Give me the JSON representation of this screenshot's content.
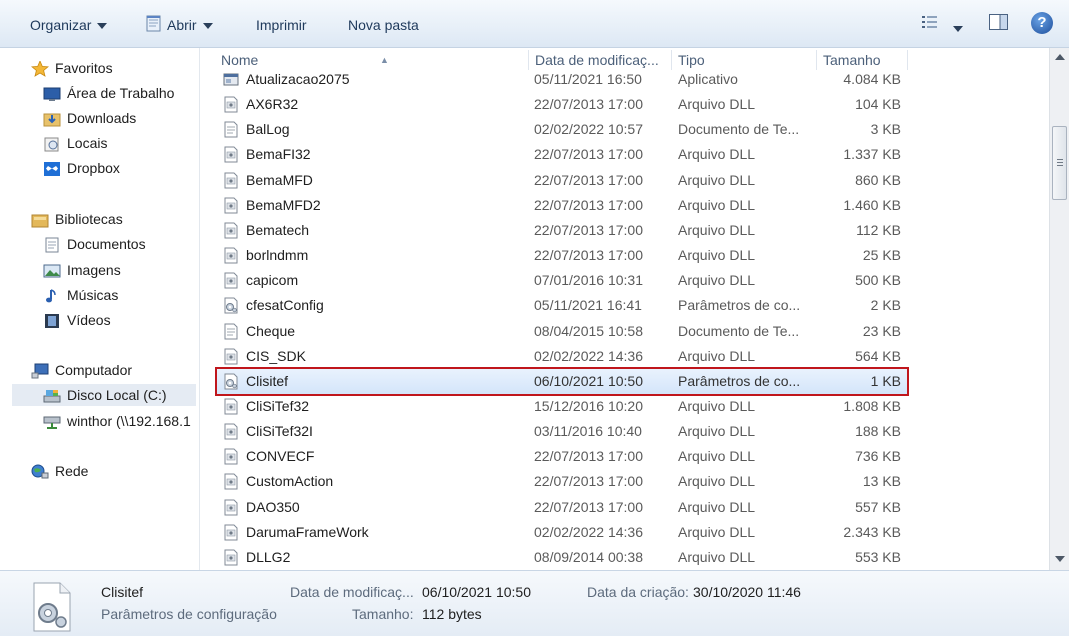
{
  "toolbar": {
    "organize": "Organizar",
    "open": "Abrir",
    "print": "Imprimir",
    "new_folder": "Nova pasta",
    "help": "?"
  },
  "nav": {
    "favorites": {
      "label": "Favoritos",
      "items": [
        "Área de Trabalho",
        "Downloads",
        "Locais",
        "Dropbox"
      ]
    },
    "libraries": {
      "label": "Bibliotecas",
      "items": [
        "Documentos",
        "Imagens",
        "Músicas",
        "Vídeos"
      ]
    },
    "computer": {
      "label": "Computador",
      "items": [
        "Disco Local (C:)",
        "winthor (\\\\192.168.1"
      ]
    },
    "network": {
      "label": "Rede"
    }
  },
  "columns": {
    "name": "Nome",
    "modified": "Data de modificaç...",
    "type": "Tipo",
    "size": "Tamanho"
  },
  "files": [
    {
      "name": "Atualizacao2075",
      "modified": "05/11/2021 16:50",
      "type": "Aplicativo",
      "size": "4.084 KB",
      "icon": "app-icon"
    },
    {
      "name": "AX6R32",
      "modified": "22/07/2013 17:00",
      "type": "Arquivo DLL",
      "size": "104 KB",
      "icon": "dll-icon"
    },
    {
      "name": "BalLog",
      "modified": "02/02/2022 10:57",
      "type": "Documento de Te...",
      "size": "3 KB",
      "icon": "text-icon"
    },
    {
      "name": "BemaFI32",
      "modified": "22/07/2013 17:00",
      "type": "Arquivo DLL",
      "size": "1.337 KB",
      "icon": "dll-icon"
    },
    {
      "name": "BemaMFD",
      "modified": "22/07/2013 17:00",
      "type": "Arquivo DLL",
      "size": "860 KB",
      "icon": "dll-icon"
    },
    {
      "name": "BemaMFD2",
      "modified": "22/07/2013 17:00",
      "type": "Arquivo DLL",
      "size": "1.460 KB",
      "icon": "dll-icon"
    },
    {
      "name": "Bematech",
      "modified": "22/07/2013 17:00",
      "type": "Arquivo DLL",
      "size": "112 KB",
      "icon": "dll-icon"
    },
    {
      "name": "borlndmm",
      "modified": "22/07/2013 17:00",
      "type": "Arquivo DLL",
      "size": "25 KB",
      "icon": "dll-icon"
    },
    {
      "name": "capicom",
      "modified": "07/01/2016 10:31",
      "type": "Arquivo DLL",
      "size": "500 KB",
      "icon": "dll-icon"
    },
    {
      "name": "cfesatConfig",
      "modified": "05/11/2021 16:41",
      "type": "Parâmetros de co...",
      "size": "2 KB",
      "icon": "config-icon"
    },
    {
      "name": "Cheque",
      "modified": "08/04/2015 10:58",
      "type": "Documento de Te...",
      "size": "23 KB",
      "icon": "text-icon"
    },
    {
      "name": "CIS_SDK",
      "modified": "02/02/2022 14:36",
      "type": "Arquivo DLL",
      "size": "564 KB",
      "icon": "dll-icon"
    },
    {
      "name": "Clisitef",
      "modified": "06/10/2021 10:50",
      "type": "Parâmetros de co...",
      "size": "1 KB",
      "icon": "config-icon",
      "selected": true
    },
    {
      "name": "CliSiTef32",
      "modified": "15/12/2016 10:20",
      "type": "Arquivo DLL",
      "size": "1.808 KB",
      "icon": "dll-icon"
    },
    {
      "name": "CliSiTef32I",
      "modified": "03/11/2016 10:40",
      "type": "Arquivo DLL",
      "size": "188 KB",
      "icon": "dll-icon"
    },
    {
      "name": "CONVECF",
      "modified": "22/07/2013 17:00",
      "type": "Arquivo DLL",
      "size": "736 KB",
      "icon": "dll-icon"
    },
    {
      "name": "CustomAction",
      "modified": "22/07/2013 17:00",
      "type": "Arquivo DLL",
      "size": "13 KB",
      "icon": "dll-icon"
    },
    {
      "name": "DAO350",
      "modified": "22/07/2013 17:00",
      "type": "Arquivo DLL",
      "size": "557 KB",
      "icon": "dll-icon"
    },
    {
      "name": "DarumaFrameWork",
      "modified": "02/02/2022 14:36",
      "type": "Arquivo DLL",
      "size": "2.343 KB",
      "icon": "dll-icon"
    },
    {
      "name": "DLLG2",
      "modified": "08/09/2014 00:38",
      "type": "Arquivo DLL",
      "size": "553 KB",
      "icon": "dll-icon"
    }
  ],
  "details": {
    "name": "Clisitef",
    "type": "Parâmetros de configuração",
    "modified_label": "Data de modificaç...",
    "modified_value": "06/10/2021 10:50",
    "size_label": "Tamanho:",
    "size_value": "112 bytes",
    "created_label": "Data da criação:",
    "created_value": "30/10/2020 11:46"
  },
  "colors": {
    "selection_outline": "#c0161c",
    "selection_fill": "#d4e5fa",
    "toolbar_text": "#1e395b"
  }
}
